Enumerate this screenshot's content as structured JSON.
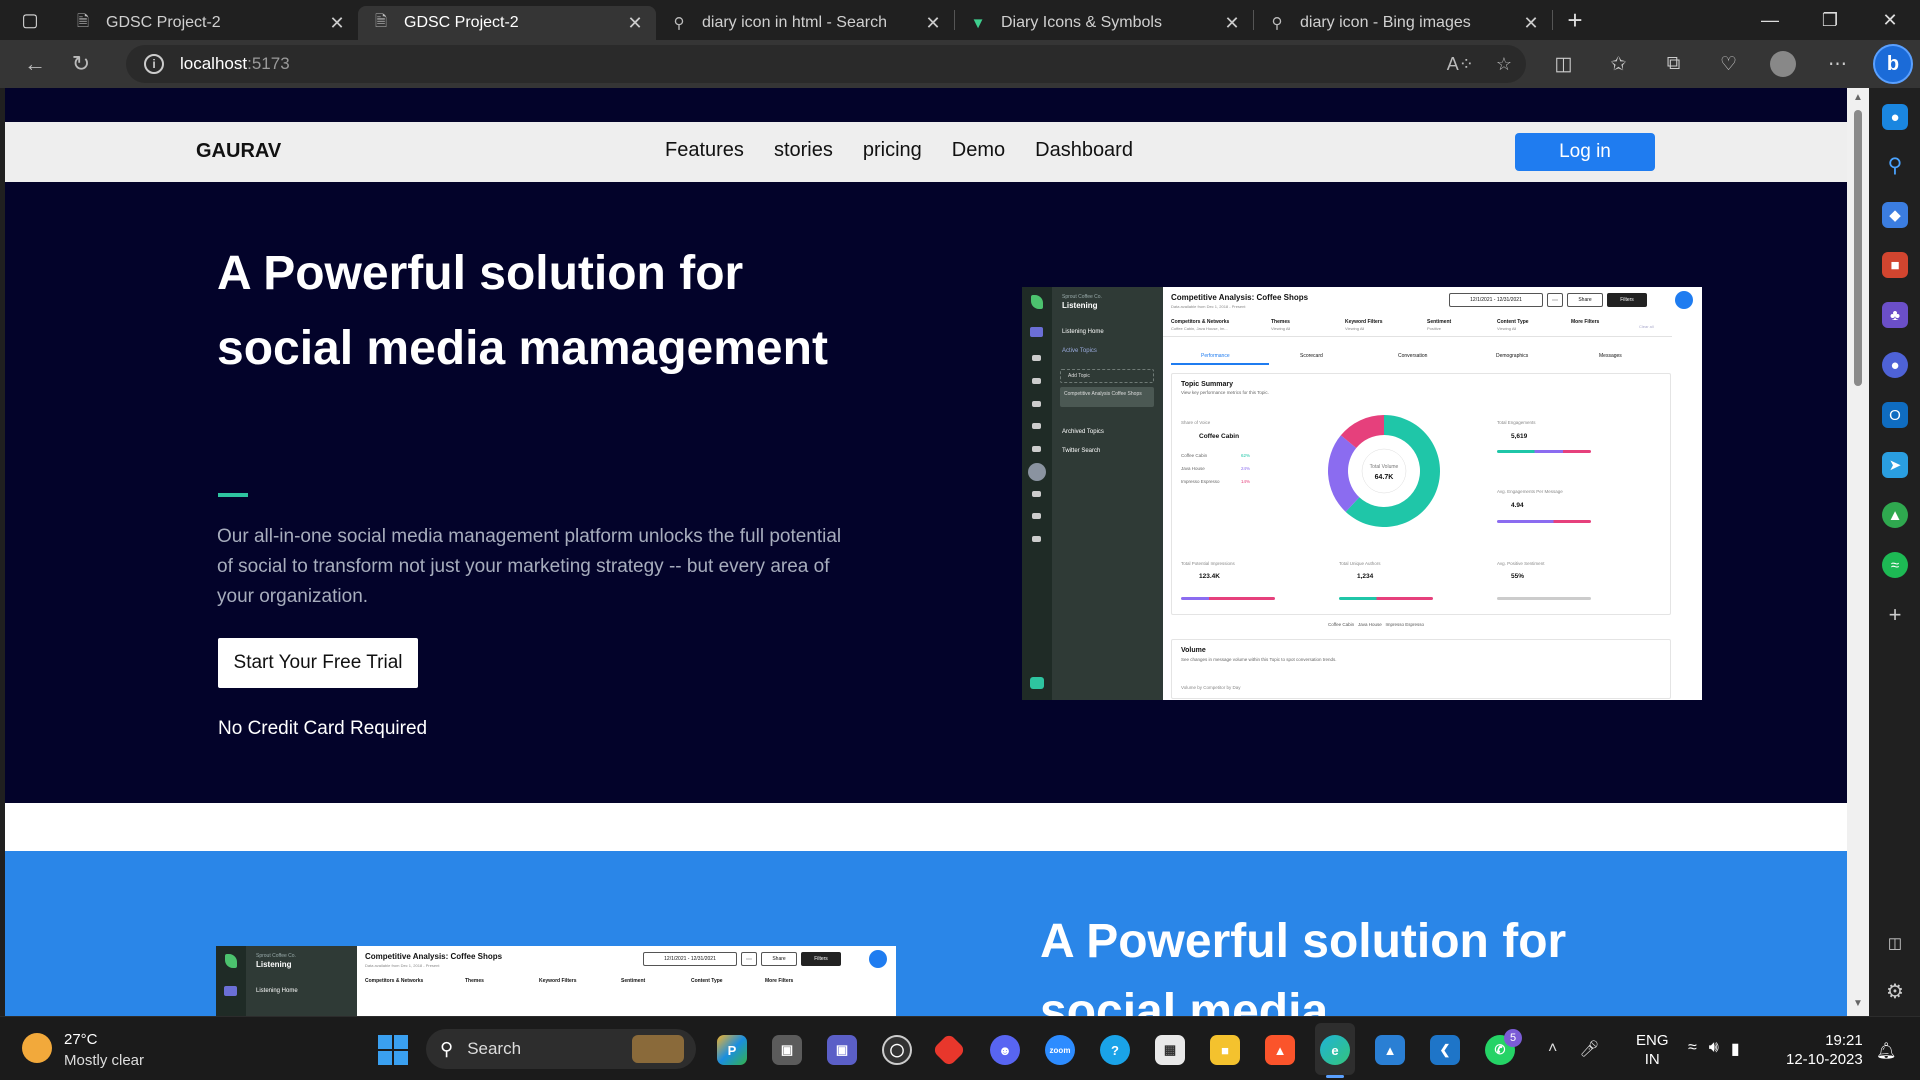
{
  "browser": {
    "tabs": [
      {
        "title": "GDSC Project-2",
        "icon": "page-icon",
        "active": false
      },
      {
        "title": "GDSC Project-2",
        "icon": "page-icon",
        "active": true
      },
      {
        "title": "diary icon in html - Search",
        "icon": "search-icon",
        "active": false
      },
      {
        "title": "Diary Icons & Symbols",
        "icon": "vector-icon",
        "active": false
      },
      {
        "title": "diary icon - Bing images",
        "icon": "search-icon",
        "active": false
      }
    ],
    "url_host": "localhost",
    "url_port": ":5173"
  },
  "page": {
    "brand": "GAURAV",
    "nav": [
      "Features",
      "stories",
      "pricing",
      "Demo",
      "Dashboard"
    ],
    "login_label": "Log in",
    "hero_title": "A Powerful solution for social media mamagement",
    "hero_desc": "Our all-in-one social media management platform unlocks the full potential of social to transform not just your marketing strategy -- but every area of your organization.",
    "cta_label": "Start Your Free Trial",
    "cta_note": "No Credit Card Required",
    "section2_title": "A Powerful solution for social media",
    "colors": {
      "hero_bg": "#03032a",
      "accent": "#2ec4a0",
      "primary": "#1f7cf0",
      "section2_bg": "#2a86e8"
    }
  },
  "mockup": {
    "workspace": "Sprout Coffee Co.",
    "app": "Listening",
    "side_items": [
      "Listening Home",
      "Active Topics",
      "Add Topic",
      "Competitive Analysis Coffee Shops",
      "Archived Topics",
      "Twitter Search"
    ],
    "title": "Competitive Analysis: Coffee Shops",
    "subtitle": "Data available from Dec 1, 2018 - Present",
    "date_range": "12/1/2021 - 12/31/2021",
    "share": "Share",
    "filters": "Filters",
    "filter_labels": [
      "Competitors & Networks",
      "Themes",
      "Keyword Filters",
      "Sentiment",
      "Content Type",
      "More Filters"
    ],
    "filter_values": [
      "Coffee Cabin, Java House, Im...",
      "Viewing All",
      "Viewing All",
      "Positive",
      "Viewing All",
      ""
    ],
    "clear_all": "Clear all",
    "tabs": [
      "Performance",
      "Scorecard",
      "Conversation",
      "Demographics",
      "Messages"
    ],
    "summary_title": "Topic Summary",
    "summary_sub": "View key performance metrics for this Topic.",
    "sov_label": "Share of Voice",
    "sov_brand": "Coffee Cabin",
    "sov_rows": [
      {
        "name": "Coffee Cabin",
        "value": "62%"
      },
      {
        "name": "Java House",
        "value": "24%"
      },
      {
        "name": "Impresso Espresso",
        "value": "14%"
      }
    ],
    "donut_label": "Total Volume",
    "donut_value": "64.7K",
    "donut_shares": [
      0.62,
      0.24,
      0.14
    ],
    "donut_colors": [
      "#1fc6a8",
      "#8b6cf0",
      "#e6407c"
    ],
    "metrics": [
      {
        "label": "Total Engagements",
        "value": "5,619"
      },
      {
        "label": "Avg. Engagements Per Message",
        "value": "4.94"
      },
      {
        "label": "Total Potential Impressions",
        "value": "123.4K"
      },
      {
        "label": "Total Unique Authors",
        "value": "1,234"
      },
      {
        "label": "Avg. Positive Sentiment",
        "value": "55%"
      }
    ],
    "legend": [
      "Coffee Cabin",
      "Java House",
      "Impresso Espresso"
    ],
    "volume_title": "Volume",
    "volume_sub": "See changes in message volume within this Topic to spot conversation trends.",
    "volume_footer": "Volume by Competitor by Day"
  },
  "taskbar": {
    "temp": "27°C",
    "weather": "Mostly clear",
    "search": "Search",
    "lang1": "ENG",
    "lang2": "IN",
    "time": "19:21",
    "date": "12-10-2023",
    "whatsapp_badge": "5",
    "zoom_label": "zoom"
  }
}
